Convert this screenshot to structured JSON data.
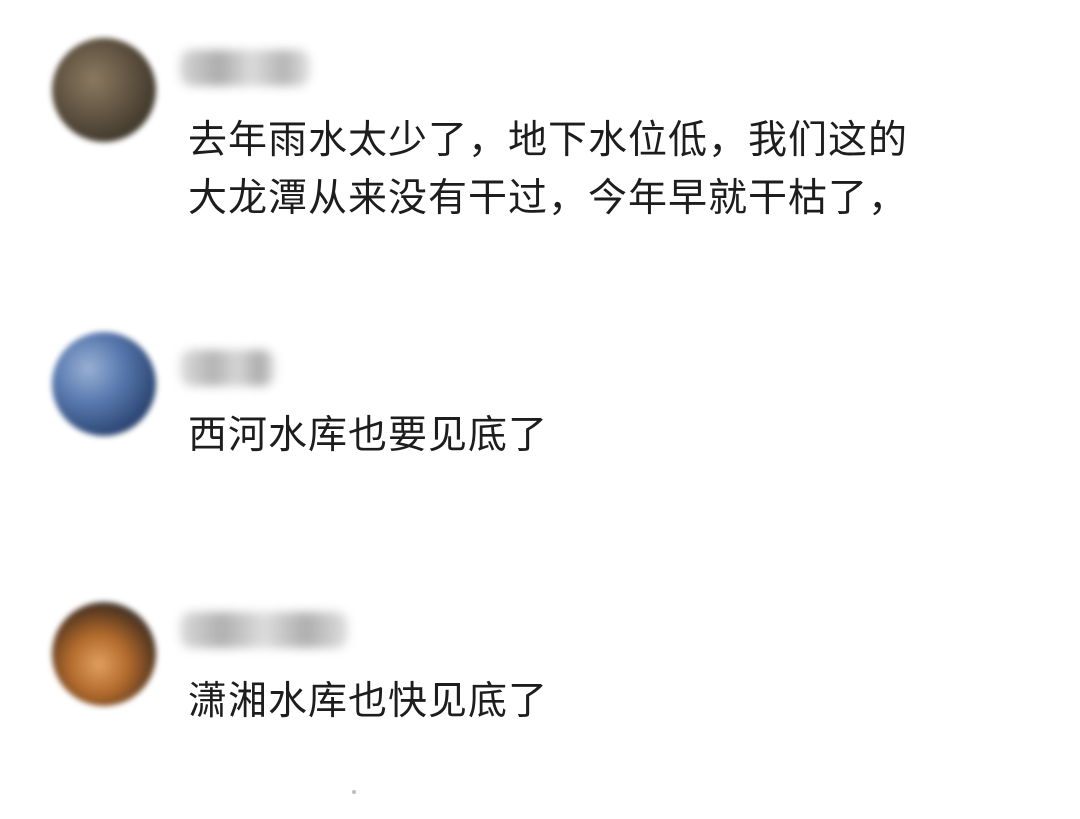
{
  "comments": [
    {
      "text": "去年雨水太少了，地下水位低，我们这的大龙潭从来没有干过，今年早就干枯了，"
    },
    {
      "text": "西河水库也要见底了"
    },
    {
      "text": "潇湘水库也快见底了"
    }
  ],
  "colors": {
    "text": "#1d1d1d",
    "username_blur": "#c8c8c8",
    "avatar1": "#6b5a45",
    "avatar2": "#3e5a86",
    "avatar3": "#b26a2c"
  }
}
